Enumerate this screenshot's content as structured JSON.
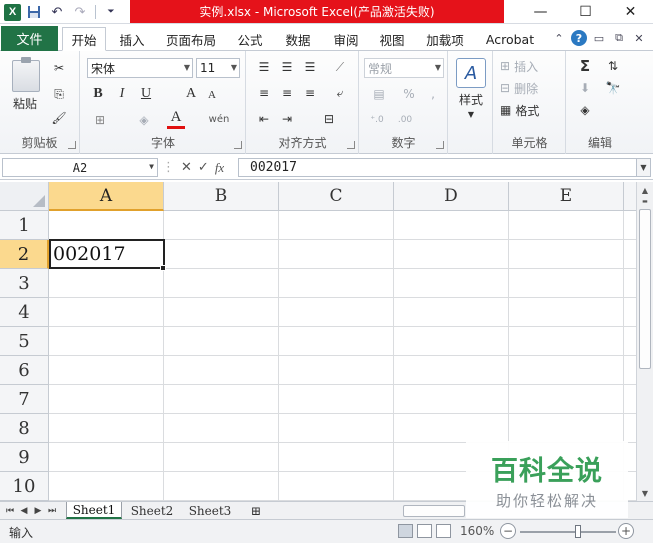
{
  "window": {
    "title": "实例.xlsx  -  Microsoft Excel(产品激活失败)",
    "controls": {
      "minimize": "—",
      "maximize": "☐",
      "close": "✕"
    }
  },
  "quick_access": {
    "app_icon": "X",
    "save": "💾",
    "undo": "↶",
    "redo": "↷",
    "customize": "⏷"
  },
  "ribbon_tabs": {
    "file": "文件",
    "items": [
      "开始",
      "插入",
      "页面布局",
      "公式",
      "数据",
      "审阅",
      "视图",
      "加载项",
      "Acrobat"
    ],
    "active_index": 0
  },
  "ribbon": {
    "clipboard": {
      "label": "剪贴板",
      "paste": "粘贴",
      "cut_icon": "✂",
      "copy_icon": "⎘",
      "format_painter_icon": "🖌"
    },
    "font": {
      "label": "字体",
      "family": "宋体",
      "size": "11",
      "bold": "B",
      "italic": "I",
      "underline": "U",
      "grow": "A",
      "shrink": "A",
      "font_color": "A",
      "wen": "wén"
    },
    "alignment": {
      "label": "对齐方式"
    },
    "number": {
      "label": "数字",
      "format": "常规",
      "percent": "%",
      "comma": ",",
      "inc_decimal": "⁺.0",
      "dec_decimal": ".00"
    },
    "styles": {
      "label": "样式",
      "button": "样式"
    },
    "cells": {
      "label": "单元格",
      "insert": "插入",
      "delete": "删除",
      "format": "格式"
    },
    "editing": {
      "label": "编辑",
      "sum": "Σ",
      "find": "🔭",
      "clear": "◈"
    }
  },
  "formula_bar": {
    "name_box": "A2",
    "fx": "fx",
    "cancel": "✕",
    "enter": "✓",
    "content": "002017"
  },
  "grid": {
    "columns": [
      "A",
      "B",
      "C",
      "D",
      "E"
    ],
    "rows": [
      "1",
      "2",
      "3",
      "4",
      "5",
      "6",
      "7",
      "8",
      "9",
      "10"
    ],
    "selected_cell": {
      "column": "A",
      "row": "2",
      "value": "002017"
    }
  },
  "sheets": {
    "tabs": [
      "Sheet1",
      "Sheet2",
      "Sheet3"
    ],
    "active_index": 0,
    "nav": [
      "⏮",
      "◀",
      "▶",
      "⏭"
    ]
  },
  "status_bar": {
    "mode": "输入",
    "zoom": "160%",
    "zoom_level": 1.6
  },
  "watermark": {
    "title": "百科全说",
    "subtitle": "助你轻松解决"
  },
  "colors": {
    "excel_green": "#217346",
    "title_banner": "#e5121a",
    "selection_header": "#fbd98e",
    "watermark_green": "#3aa05a"
  }
}
